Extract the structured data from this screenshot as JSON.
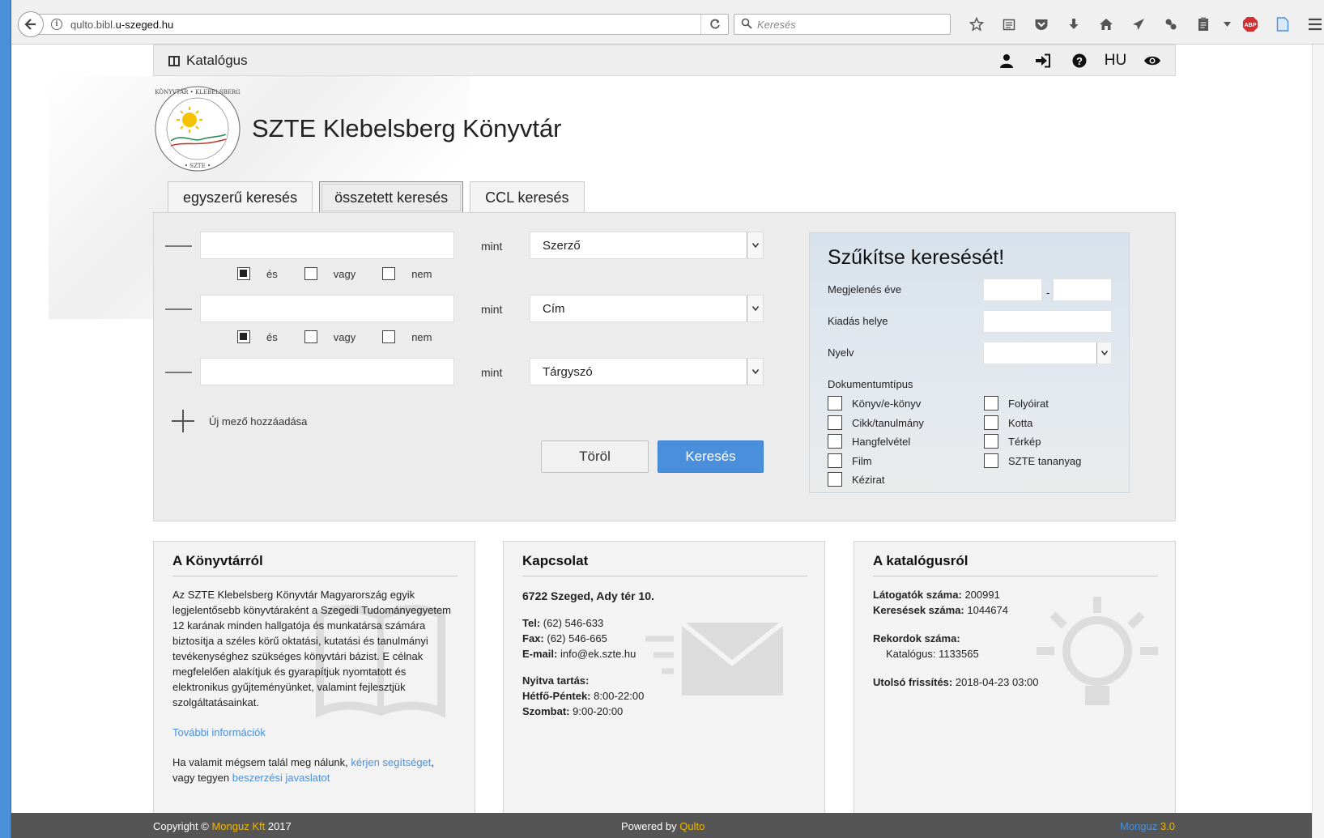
{
  "browser": {
    "url_prefix": "qulto.bibl.",
    "url_domain": "u-szeged.hu",
    "search_placeholder": "Keresés",
    "abp_label": "ABP"
  },
  "nav": {
    "brand": "Katalógus",
    "lang": "HU"
  },
  "site": {
    "title": "SZTE Klebelsberg Könyvtár",
    "logo_text_top": "KÖNYVTÁR • KLEBELSBERG",
    "logo_text_bottom": "• SZTE •"
  },
  "tabs": [
    {
      "label": "egyszerű keresés"
    },
    {
      "label": "összetett keresés"
    },
    {
      "label": "CCL keresés"
    }
  ],
  "search": {
    "rows": [
      {
        "value": "",
        "connector": "mint",
        "field": "Szerző"
      },
      {
        "value": "",
        "connector": "mint",
        "field": "Cím"
      },
      {
        "value": "",
        "connector": "mint",
        "field": "Tárgyszó"
      }
    ],
    "bool_and": "és",
    "bool_or": "vagy",
    "bool_not": "nem",
    "add_field": "Új mező hozzáadása",
    "clear": "Töröl",
    "submit": "Keresés"
  },
  "refine": {
    "title": "Szűkítse keresését!",
    "year_label": "Megjelenés éve",
    "year_sep": "-",
    "place_label": "Kiadás helye",
    "lang_label": "Nyelv",
    "doctype_label": "Dokumentumtípus",
    "doctypes_left": [
      "Könyv/e-könyv",
      "Cikk/tanulmány",
      "Hangfelvétel",
      "Film",
      "Kézirat"
    ],
    "doctypes_right": [
      "Folyóirat",
      "Kotta",
      "Térkép",
      "SZTE tananyag"
    ]
  },
  "about": {
    "title": "A Könyvtárról",
    "body": "Az SZTE Klebelsberg Könyvtár Magyarország egyik legjelentősebb könyvtáraként a Szegedi Tudományegyetem 12 karának minden hallgatója és munkatársa számára biztosítja a széles körű oktatási, kutatási és tanulmányi tevékenységhez szükséges könyvtári bázist. E célnak megfelelően alakítjuk és gyarapítjuk nyomtatott és elektronikus gyűjteményünket, valamint fejlesztjük szolgáltatásainkat.",
    "more": "További információk",
    "help_pre": "Ha valamit mégsem talál meg nálunk,",
    "help_link": "kérjen segítséget",
    "help_mid": ", vagy tegyen",
    "help_link2": "beszerzési javaslatot"
  },
  "contact": {
    "title": "Kapcsolat",
    "address": "6722 Szeged, Ady tér 10.",
    "tel_label": "Tel:",
    "tel": "(62) 546-633",
    "fax_label": "Fax:",
    "fax": "(62) 546-665",
    "email_label": "E-mail:",
    "email": "info@ek.szte.hu",
    "hours_label": "Nyitva tartás:",
    "weekday_label": "Hétfő-Péntek:",
    "weekday": "8:00-22:00",
    "sat_label": "Szombat:",
    "sat": "9:00-20:00"
  },
  "catalog": {
    "title": "A katalógusról",
    "visitors_label": "Látogatók száma:",
    "visitors": "200991",
    "searches_label": "Keresések száma:",
    "searches": "1044674",
    "records_label": "Rekordok száma:",
    "catalog_label": "Katalógus:",
    "catalog_count": "1133565",
    "updated_label": "Utolsó frissítés:",
    "updated": "2018-04-23 03:00"
  },
  "footer": {
    "copy_pre": "Copyright ©",
    "company": "Monguz Kft",
    "year": "2017",
    "powered_pre": "Powered by",
    "powered": "Qulto",
    "ver_name": "Monguz",
    "ver_num": "3.0"
  },
  "colors": {
    "accent": "#4a8fdc",
    "orange": "#f0b400",
    "footer": "#555555"
  }
}
